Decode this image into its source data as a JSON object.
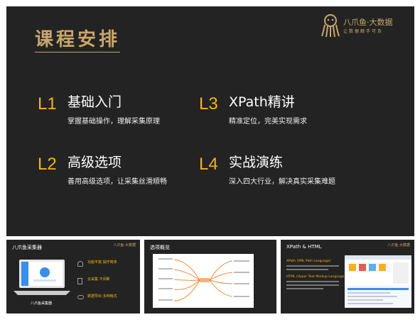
{
  "main_slide": {
    "title": "课程安排",
    "logo_text": "八爪鱼·大数据",
    "logo_sub": "让数据触手可及",
    "lessons": [
      {
        "num": "L1",
        "title": "基础入门",
        "desc": "掌握基础操作，理解采集原理"
      },
      {
        "num": "L3",
        "title": "XPath精讲",
        "desc": "精准定位，完美实现需求"
      },
      {
        "num": "L2",
        "title": "高级选项",
        "desc": "善用高级选项，让采集丝滑顺畅"
      },
      {
        "num": "L4",
        "title": "实战演练",
        "desc": "深入四大行业，解决真实采集难题"
      }
    ]
  },
  "thumbnails": [
    {
      "title": "八爪鱼采集器",
      "logo": "八爪鱼·大数据",
      "app_label": "八爪鱼采集器",
      "bullets": [
        "功能丰富 操作简单",
        "云采集 不间断",
        "数据导出 多种格式"
      ],
      "accent": "#f2b417"
    },
    {
      "title": "选项概览",
      "logo": ""
    },
    {
      "title": "XPath & HTML",
      "logo": "八爪鱼·大数据",
      "paragraph_heads": [
        "XPath (XML Path Language)",
        "HTML (Hyper Text Markup Language)"
      ]
    }
  ]
}
